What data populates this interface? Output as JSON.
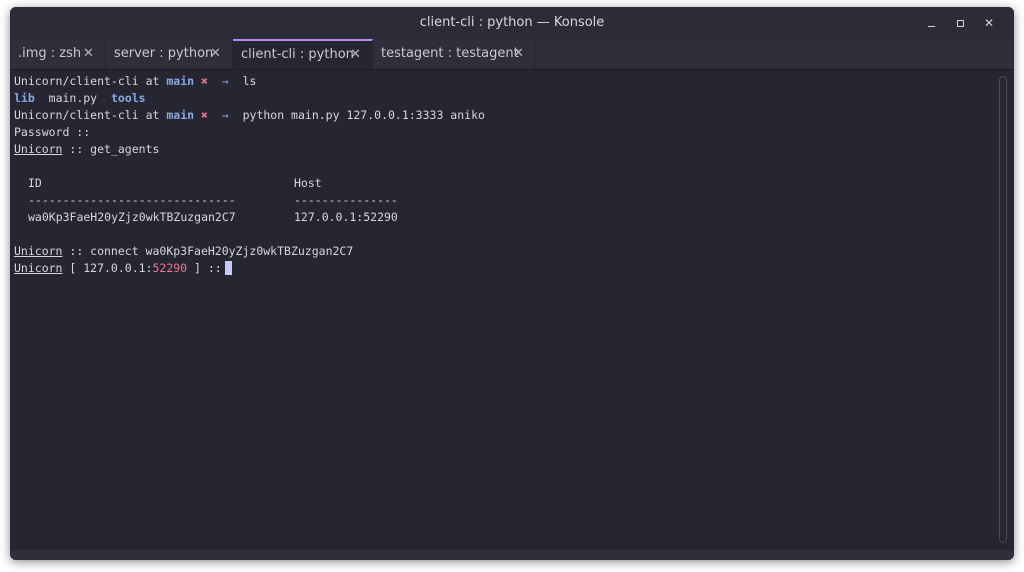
{
  "window": {
    "title": "client-cli : python — Konsole"
  },
  "tabs": [
    {
      "label": ".img : zsh",
      "close": "✕"
    },
    {
      "label": "server : python",
      "close": "✕"
    },
    {
      "label": "client-cli : python",
      "close": "✕",
      "active": true
    },
    {
      "label": "testagent : testagent",
      "close": "✕"
    }
  ],
  "terminal": {
    "prompt": {
      "path": "Unicorn/client-cli",
      "at": "at",
      "branch": "main",
      "dirty": "✖",
      "arrow": "→"
    },
    "cmd1": "ls",
    "ls_output": {
      "lib": "lib",
      "main": "main.py",
      "tools": "tools"
    },
    "cmd2": "python main.py 127.0.0.1:3333 aniko",
    "password_line": "Password ::",
    "unicorn": "Unicorn",
    "get_agents_cmd": " :: get_agents",
    "table": {
      "col_id": "ID",
      "col_host": "Host",
      "sep_id": "------------------------------",
      "sep_host": "---------------",
      "rows": [
        {
          "id": "wa0Kp3FaeH20yZjz0wkTBZuzgan2C7",
          "host": "127.0.0.1:52290"
        }
      ]
    },
    "connect_cmd": " :: connect wa0Kp3FaeH20yZjz0wkTBZuzgan2C7",
    "session_prompt": {
      "open": " [ 127.0.0.1:",
      "port": "52290",
      "close": " ] ::"
    }
  }
}
